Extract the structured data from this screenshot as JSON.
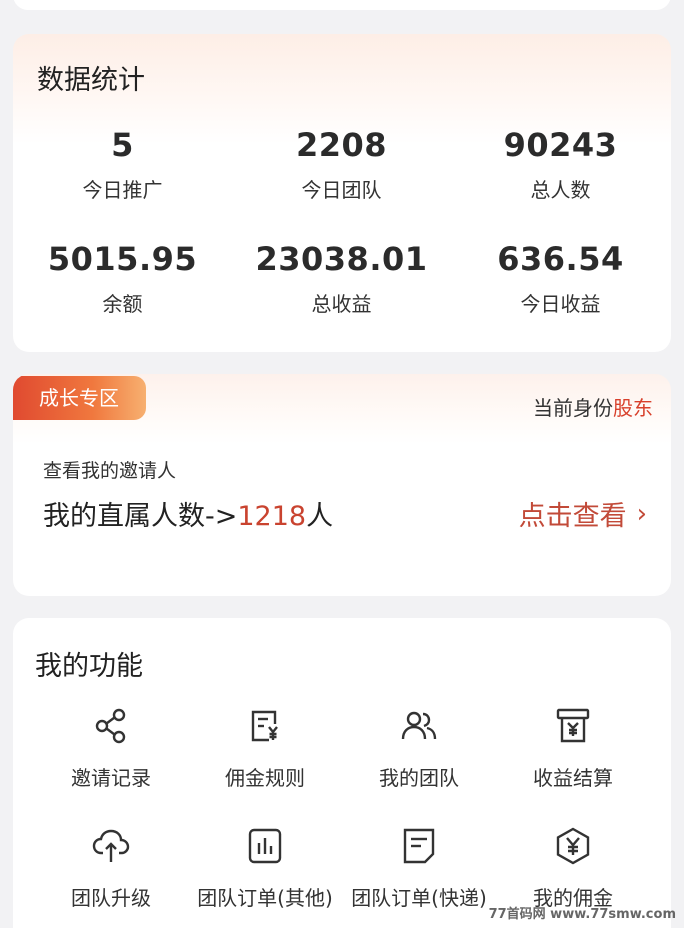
{
  "stats": {
    "title": "数据统计",
    "items": [
      {
        "value": "5",
        "label": "今日推广"
      },
      {
        "value": "2208",
        "label": "今日团队"
      },
      {
        "value": "90243",
        "label": "总人数"
      },
      {
        "value": "5015.95",
        "label": "余额"
      },
      {
        "value": "23038.01",
        "label": "总收益"
      },
      {
        "value": "636.54",
        "label": "今日收益"
      }
    ]
  },
  "growth": {
    "badge": "成长专区",
    "identity_label": "当前身份",
    "identity_role": "股东",
    "invite_label": "查看我的邀请人",
    "direct_prefix": "我的直属人数->",
    "direct_count": "1218",
    "direct_suffix": "人",
    "view_label": "点击查看",
    "view_chevron": "›"
  },
  "functions": {
    "title": "我的功能",
    "items": [
      {
        "label": "邀请记录",
        "icon": "share-icon"
      },
      {
        "label": "佣金规则",
        "icon": "rules-icon"
      },
      {
        "label": "我的团队",
        "icon": "team-icon"
      },
      {
        "label": "收益结算",
        "icon": "settlement-icon"
      },
      {
        "label": "团队升级",
        "icon": "cloud-upload-icon"
      },
      {
        "label": "团队订单(其他)",
        "icon": "bar-chart-icon"
      },
      {
        "label": "团队订单(快递)",
        "icon": "document-icon"
      },
      {
        "label": "我的佣金",
        "icon": "commission-icon"
      }
    ]
  },
  "watermark": "77首码网 www.77smw.com",
  "colors": {
    "accent_red": "#d8402b",
    "badge_start": "#e04a30",
    "badge_end": "#f7b070"
  }
}
